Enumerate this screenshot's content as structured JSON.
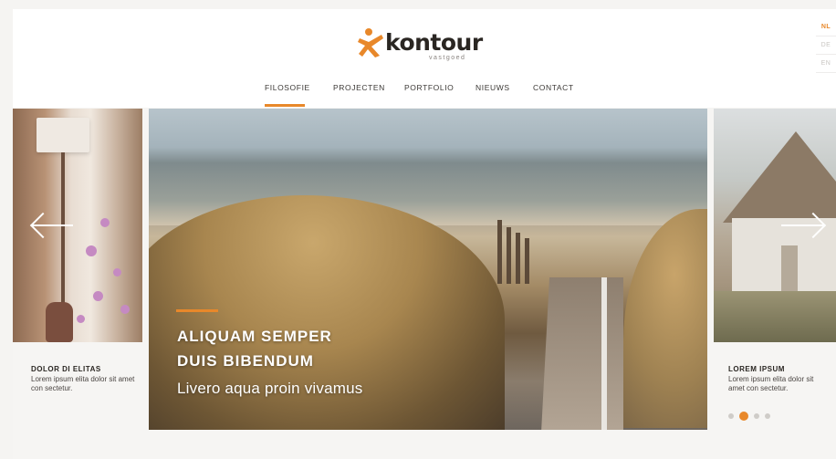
{
  "header": {
    "logo_text": "kontour",
    "logo_sub": "vastgoed"
  },
  "nav": {
    "items": [
      {
        "label": "FILOSOFIE",
        "active": true
      },
      {
        "label": "PROJECTEN"
      },
      {
        "label": "PORTFOLIO"
      },
      {
        "label": "NIEUWS"
      },
      {
        "label": "CONTACT"
      }
    ]
  },
  "languages": {
    "items": [
      {
        "label": "NL",
        "active": true
      },
      {
        "label": "DE"
      },
      {
        "label": "EN"
      }
    ]
  },
  "slider": {
    "left": {
      "title": "DOLOR DI ELITAS",
      "body": "Lorem ipsum elita dolor sit amet con sectetur."
    },
    "main": {
      "title_line1": "ALIQUAM SEMPER",
      "title_line2": "DUIS BIBENDUM",
      "subtitle": "Livero aqua proin vivamus"
    },
    "right": {
      "title": "LOREM IPSUM",
      "body": "Lorem ipsum elita dolor sit amet con sectetur."
    },
    "dots": {
      "count": 4,
      "active_index": 1
    },
    "prev_icon": "arrow-left-icon",
    "next_icon": "arrow-right-icon"
  },
  "colors": {
    "accent": "#e8882a",
    "text_dark": "#2a2622",
    "background": "#f6f5f3"
  }
}
